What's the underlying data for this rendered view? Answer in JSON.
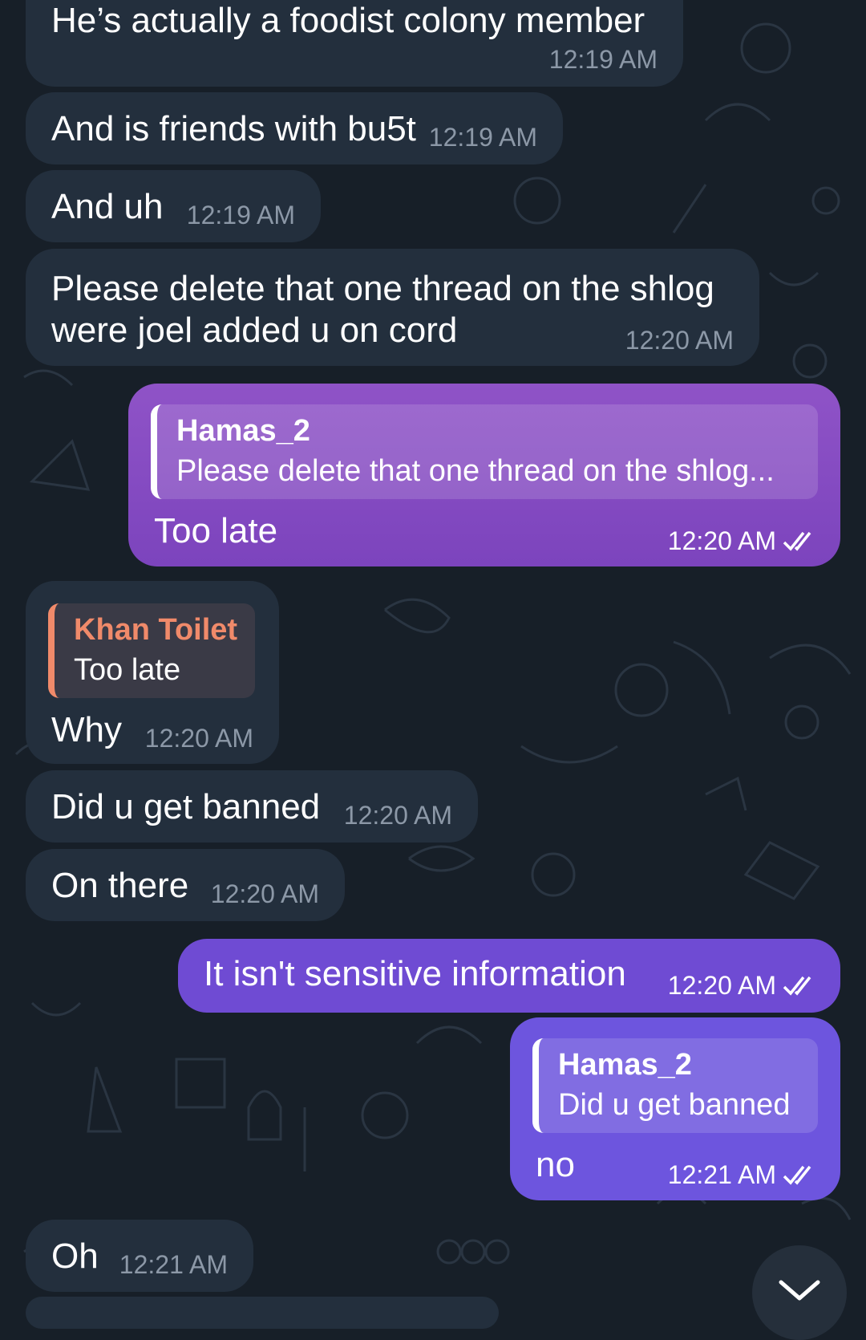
{
  "messages": [
    {
      "text": "He’s actually a foodist colony member",
      "time": "12:19 AM"
    },
    {
      "text": "And is friends with bu5t",
      "time": "12:19 AM"
    },
    {
      "text": "And uh",
      "time": "12:19 AM"
    },
    {
      "text_line1": "Please delete that one thread on the shlog",
      "text_line2": "were joel added u on cord",
      "time": "12:20 AM"
    },
    {
      "reply_name": "Hamas_2",
      "reply_text": "Please delete that one thread on the shlog...",
      "text": "Too late",
      "time": "12:20 AM"
    },
    {
      "reply_name": "Khan Toilet",
      "reply_text": "Too late",
      "text": "Why",
      "time": "12:20 AM"
    },
    {
      "text": "Did u get banned",
      "time": "12:20 AM"
    },
    {
      "text": "On there",
      "time": "12:20 AM"
    },
    {
      "text": "It isn't sensitive information",
      "time": "12:20 AM"
    },
    {
      "reply_name": "Hamas_2",
      "reply_text": "Did u get banned",
      "text": "no",
      "time": "12:21 AM"
    },
    {
      "text": "Oh",
      "time": "12:21 AM"
    }
  ],
  "icons": {
    "read_receipt": "double-check-icon",
    "scroll_down": "chevron-down-icon"
  },
  "colors": {
    "background": "#171f28",
    "incoming_bubble": "#232f3d",
    "outgoing_purple": "#8a4fc5",
    "outgoing_violet": "#6d55de",
    "reply_name_incoming": "#f08a6a"
  }
}
